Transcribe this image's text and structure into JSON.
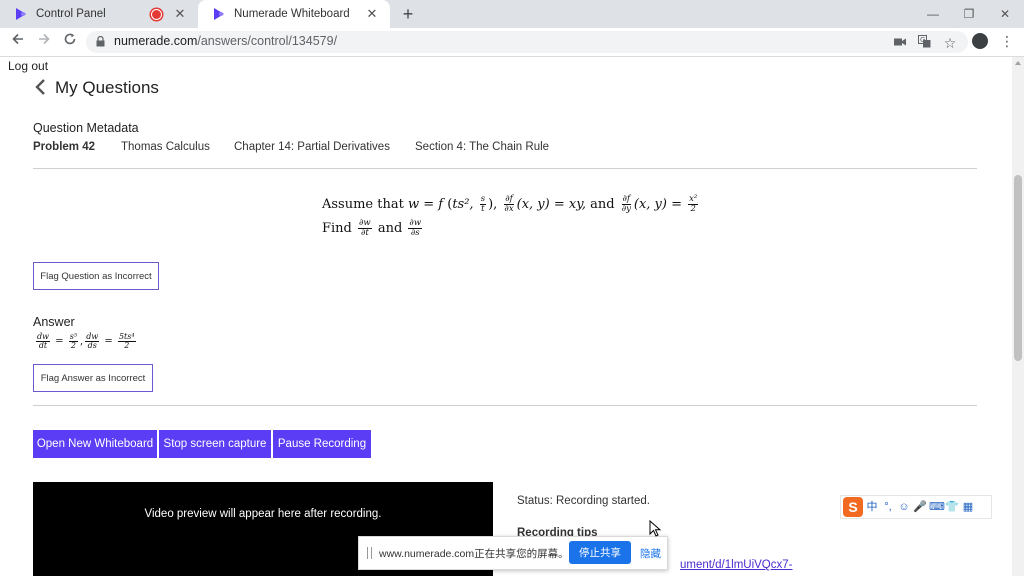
{
  "browser": {
    "tabs": [
      {
        "title": "Control Panel",
        "active": false,
        "recording": true
      },
      {
        "title": "Numerade Whiteboard",
        "active": true,
        "recording": false
      }
    ],
    "new_tab_symbol": "+",
    "window_controls": {
      "minimize": "—",
      "restore": "❐",
      "close": "✕"
    },
    "address": {
      "domain": "numerade.com",
      "path": "/answers/control/134579/"
    },
    "nav_icons": [
      "back-arrow-icon",
      "forward-arrow-icon",
      "reload-icon"
    ],
    "omnibox_icons": [
      "camera-icon",
      "translate-icon",
      "star-icon"
    ]
  },
  "page": {
    "logout": "Log out",
    "title": "My Questions",
    "metadata": {
      "heading": "Question Metadata",
      "problem": "Problem 42",
      "book": "Thomas Calculus",
      "chapter": "Chapter 14: Partial Derivatives",
      "section": "Section 4: The Chain Rule"
    },
    "question": {
      "line1": {
        "assume": "Assume that",
        "w": "w",
        "eq_f": "= f",
        "ts2": "ts²,",
        "s_over_t": {
          "num": "s",
          "den": "t"
        },
        "df": "∂f",
        "dx": "∂x",
        "dy": "∂y",
        "xy_expr": "(x, y) = xy,",
        "and": "and",
        "xy_eq": "(x, y) =",
        "x2_over_2": {
          "num": "x²",
          "den": "2"
        }
      },
      "line2": {
        "find": "Find",
        "dw_dt": {
          "num": "∂w",
          "den": "∂t"
        },
        "and": "and",
        "dw_ds": {
          "num": "∂w",
          "den": "∂s"
        }
      }
    },
    "flag_question": "Flag Question as Incorrect",
    "answer": {
      "heading": "Answer",
      "dw_dt": {
        "num": "dw",
        "den": "dt"
      },
      "s5_over_2": {
        "num": "s⁵",
        "den": "2"
      },
      "dw_ds": {
        "num": "dw",
        "den": "ds"
      },
      "ts4_over_2": {
        "num": "5ts⁴",
        "den": "2"
      },
      "equals": "=",
      "comma": ","
    },
    "flag_answer": "Flag Answer as Incorrect",
    "buttons": {
      "open_whiteboard": "Open New Whiteboard",
      "stop_capture": "Stop screen capture",
      "pause_recording": "Pause Recording"
    },
    "video_preview": "Video preview will appear here after recording.",
    "status": "Status: Recording started.",
    "recording_tips": "Recording tips",
    "doc_link": "ument/d/1lmUiVQcx7-"
  },
  "ime_toolbar": {
    "logo": "S",
    "items": [
      "中",
      "°,",
      "☺",
      "🎤",
      "⌨",
      "👕",
      "▦"
    ]
  },
  "share_bar": {
    "message": "www.numerade.com正在共享您的屏幕。",
    "stop": "停止共享",
    "hide": "隐藏"
  },
  "colors": {
    "accent_purple": "#5b3df5",
    "outline_purple": "#6a5acd",
    "share_blue": "#1a73e8",
    "recording_red": "#e53935"
  }
}
